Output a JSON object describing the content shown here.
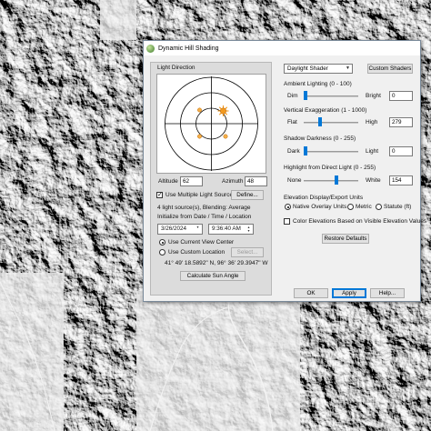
{
  "window": {
    "title": "Dynamic Hill Shading"
  },
  "light_panel": {
    "title": "Light Direction",
    "altitude_label": "Altitude",
    "altitude_value": "62",
    "azimuth_label": "Azimuth",
    "azimuth_value": "48",
    "multiple_lights_label": "Use Multiple Light Sources",
    "multiple_lights_checked": true,
    "define_label": "Define...",
    "sources_info": "4 light source(s), Blending: Average",
    "init_label": "Initialize from Date / Time / Location",
    "date_value": "3/26/2024",
    "time_value": "9:36:40 AM",
    "use_view_center_label": "Use Current View Center",
    "use_custom_location_label": "Use Custom Location",
    "select_label": "Select...",
    "coordinates": "41° 49' 18.5892\" N, 96° 36' 29.3947\" W",
    "calc_sun_label": "Calculate Sun Angle"
  },
  "shader": {
    "selected": "Daylight Shader",
    "custom_shaders_label": "Custom Shaders",
    "ambient_label": "Ambient Lighting (0 - 100)",
    "ambient_min": "Dim",
    "ambient_max": "Bright",
    "ambient_value": "0",
    "ambient_level": 0,
    "vertical_label": "Vertical Exaggeration (1 - 1000)",
    "vertical_min": "Flat",
    "vertical_max": "High",
    "vertical_value": "279",
    "vertical_level": 0.279,
    "shadow_label": "Shadow Darkness (0 - 255)",
    "shadow_min": "Dark",
    "shadow_max": "Light",
    "shadow_value": "0",
    "shadow_level": 0,
    "highlight_label": "Highlight from Direct Light (0 - 255)",
    "highlight_min": "None",
    "highlight_max": "White",
    "highlight_value": "154",
    "highlight_level": 0.604,
    "units_label": "Elevation Display/Export Units",
    "unit_native": "Native Overlay Units",
    "unit_metric": "Metric",
    "unit_statute": "Statute (ft)",
    "color_elev_label": "Color Elevations Based on Visible Elevation Values",
    "restore_label": "Restore Defaults"
  },
  "footer": {
    "ok_label": "OK",
    "apply_label": "Apply",
    "help_label": "Help..."
  },
  "colors": {
    "accent": "#0078d7",
    "sun": "#f29a1f",
    "light_source": "#f5b04a"
  }
}
